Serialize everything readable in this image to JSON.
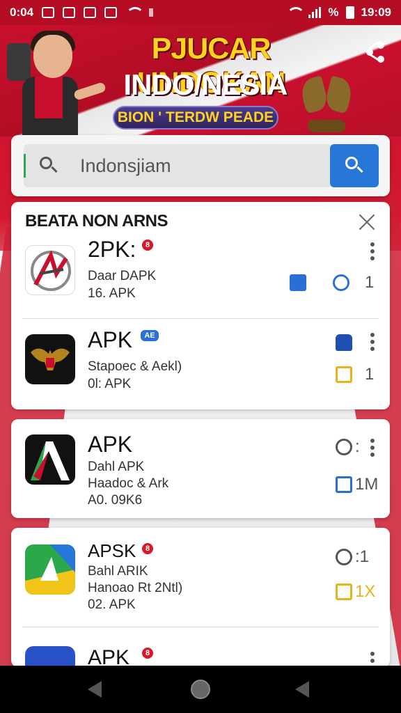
{
  "status_bar": {
    "time_left": "0:04",
    "time_right": "19:09",
    "battery_label": "%"
  },
  "banner": {
    "title": "PJUCAR UNDOKAN",
    "subtitle": "INDO/NESIA",
    "pill": "BION ' TERDW PEADE"
  },
  "search": {
    "value": "Indonsjiam",
    "placeholder": "Indonsjiam"
  },
  "results": {
    "header": "BEATA NON ARNS",
    "apps": [
      {
        "title": "2PK:",
        "badge": "8",
        "line1": "Daar DAPK",
        "line2": "16. APK",
        "action_num": "1"
      },
      {
        "title": "APK",
        "badge": "AE",
        "line1": "Stapoec & Aekl)",
        "line2": "0l: APK",
        "action_num": "1"
      }
    ]
  },
  "cards": [
    {
      "title": "APK",
      "line1": "Dahl APK",
      "line2": "Haadoc & Ark",
      "line3": "A0. 09K6",
      "action_num": "1M",
      "top_action": ":"
    },
    {
      "title": "APSK",
      "badge": "8",
      "line1": "Bahl ARIK",
      "line2": "Hanoao Rt 2Ntl)",
      "line3": "02. APK",
      "action_num": "1X",
      "top_action": ":1"
    },
    {
      "title": "APK",
      "badge": "8"
    }
  ],
  "colors": {
    "accent": "#2777d8",
    "flag_red": "#c8102e",
    "gold": "#ffd21f"
  }
}
